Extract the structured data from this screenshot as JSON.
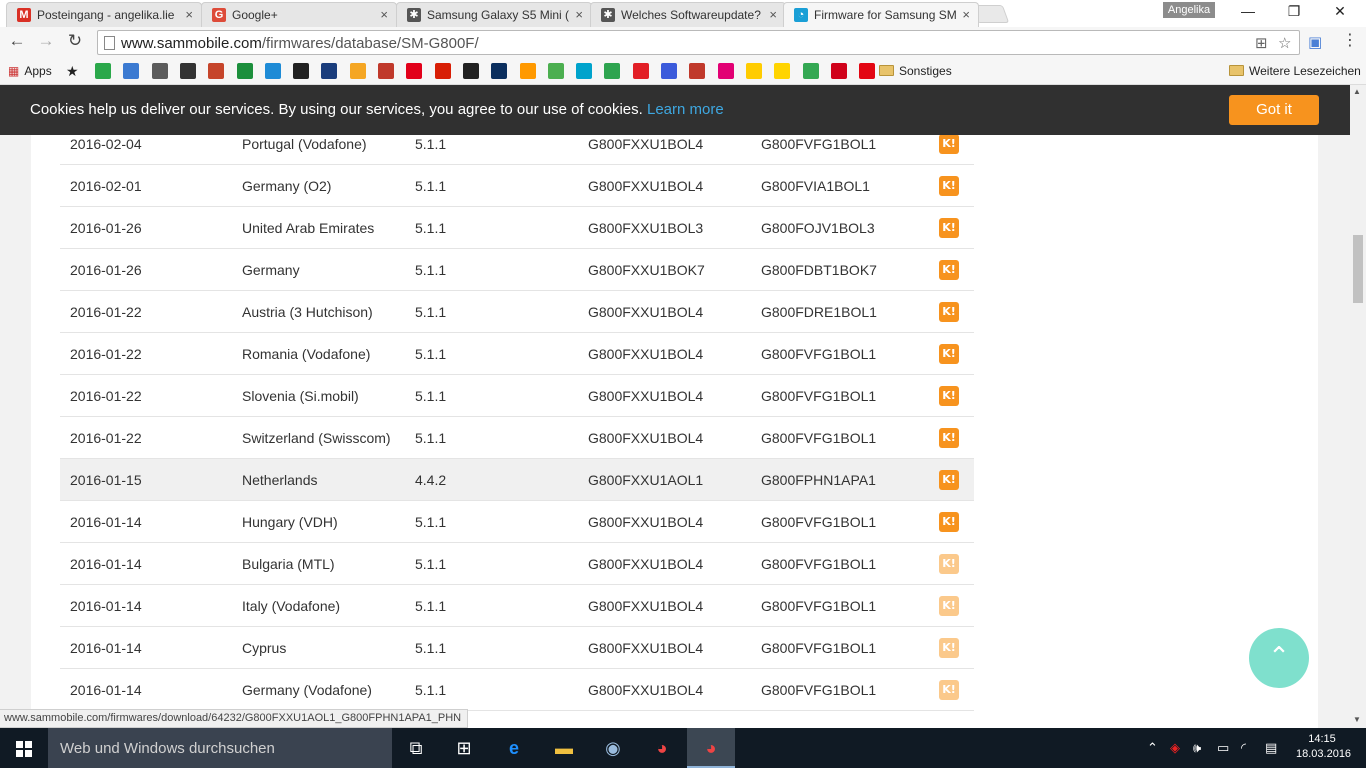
{
  "browser": {
    "tabs": [
      {
        "title": "Posteingang - angelika.lie",
        "icon": "gmail-icon",
        "color": "#d93025",
        "glyph": "M",
        "active": false
      },
      {
        "title": "Google+",
        "icon": "google-plus-icon",
        "color": "#dd4b39",
        "glyph": "G",
        "active": false
      },
      {
        "title": "Samsung Galaxy S5 Mini (",
        "icon": "android-icon",
        "color": "#555555",
        "glyph": "✱",
        "active": false
      },
      {
        "title": "Welches Softwareupdate?",
        "icon": "android-icon",
        "color": "#555555",
        "glyph": "✱",
        "active": false
      },
      {
        "title": "Firmware for Samsung SM",
        "icon": "sammobile-icon",
        "color": "#1a9fd6",
        "glyph": "◔",
        "active": true
      }
    ],
    "profile_name": "Angelika",
    "url_domain": "www.sammobile.com",
    "url_path": "/firmwares/database/SM-G800F/",
    "apps_label": "Apps",
    "bookmark_folder": "Sonstiges",
    "other_bookmarks": "Weitere Lesezeichen",
    "bookmark_icon_colors": [
      "#2aa84a",
      "#3b7ad1",
      "#5c5c5c",
      "#333333",
      "#c6452b",
      "#1c8f3c",
      "#1e8bd6",
      "#222222",
      "#1a3d7c",
      "#f5a623",
      "#c0392b",
      "#e2001a",
      "#d81e05",
      "#222222",
      "#0b2f5e",
      "#ff9900",
      "#4caf50",
      "#00a3cc",
      "#2ea44f",
      "#e21f26",
      "#3b5bdb",
      "#c0392b",
      "#e20074",
      "#ffcc00",
      "#ffd400",
      "#34a853",
      "#d0021b",
      "#e30613"
    ]
  },
  "cookie_banner": {
    "message": "Cookies help us deliver our services. By using our services, you agree to our use of cookies.",
    "learn_more": "Learn more",
    "button": "Got it"
  },
  "firmware_rows": [
    {
      "date": "2016-02-04",
      "region": "Portugal (Vodafone)",
      "os": "5.1.1",
      "pda": "G800FXXU1BOL4",
      "csc": "G800FVFG1BOL1",
      "faded": false,
      "highlight": false
    },
    {
      "date": "2016-02-01",
      "region": "Germany (O2)",
      "os": "5.1.1",
      "pda": "G800FXXU1BOL4",
      "csc": "G800FVIA1BOL1",
      "faded": false,
      "highlight": false
    },
    {
      "date": "2016-01-26",
      "region": "United Arab Emirates",
      "os": "5.1.1",
      "pda": "G800FXXU1BOL3",
      "csc": "G800FOJV1BOL3",
      "faded": false,
      "highlight": false
    },
    {
      "date": "2016-01-26",
      "region": "Germany",
      "os": "5.1.1",
      "pda": "G800FXXU1BOK7",
      "csc": "G800FDBT1BOK7",
      "faded": false,
      "highlight": false
    },
    {
      "date": "2016-01-22",
      "region": "Austria (3 Hutchison)",
      "os": "5.1.1",
      "pda": "G800FXXU1BOL4",
      "csc": "G800FDRE1BOL1",
      "faded": false,
      "highlight": false
    },
    {
      "date": "2016-01-22",
      "region": "Romania (Vodafone)",
      "os": "5.1.1",
      "pda": "G800FXXU1BOL4",
      "csc": "G800FVFG1BOL1",
      "faded": false,
      "highlight": false
    },
    {
      "date": "2016-01-22",
      "region": "Slovenia (Si.mobil)",
      "os": "5.1.1",
      "pda": "G800FXXU1BOL4",
      "csc": "G800FVFG1BOL1",
      "faded": false,
      "highlight": false
    },
    {
      "date": "2016-01-22",
      "region": "Switzerland (Swisscom)",
      "os": "5.1.1",
      "pda": "G800FXXU1BOL4",
      "csc": "G800FVFG1BOL1",
      "faded": false,
      "highlight": false
    },
    {
      "date": "2016-01-15",
      "region": "Netherlands",
      "os": "4.4.2",
      "pda": "G800FXXU1AOL1",
      "csc": "G800FPHN1APA1",
      "faded": false,
      "highlight": true
    },
    {
      "date": "2016-01-14",
      "region": "Hungary (VDH)",
      "os": "5.1.1",
      "pda": "G800FXXU1BOL4",
      "csc": "G800FVFG1BOL1",
      "faded": false,
      "highlight": false
    },
    {
      "date": "2016-01-14",
      "region": "Bulgaria (MTL)",
      "os": "5.1.1",
      "pda": "G800FXXU1BOL4",
      "csc": "G800FVFG1BOL1",
      "faded": true,
      "highlight": false
    },
    {
      "date": "2016-01-14",
      "region": "Italy (Vodafone)",
      "os": "5.1.1",
      "pda": "G800FXXU1BOL4",
      "csc": "G800FVFG1BOL1",
      "faded": true,
      "highlight": false
    },
    {
      "date": "2016-01-14",
      "region": "Cyprus",
      "os": "5.1.1",
      "pda": "G800FXXU1BOL4",
      "csc": "G800FVFG1BOL1",
      "faded": true,
      "highlight": false
    },
    {
      "date": "2016-01-14",
      "region": "Germany (Vodafone)",
      "os": "5.1.1",
      "pda": "G800FXXU1BOL4",
      "csc": "G800FVFG1BOL1",
      "faded": true,
      "highlight": false
    }
  ],
  "download_glyph": "K!",
  "status_url": "www.sammobile.com/firmwares/download/64232/G800FXXU1AOL1_G800FPHN1APA1_PHN",
  "taskbar": {
    "search_placeholder": "Web und Windows durchsuchen",
    "time": "14:15",
    "date": "18.03.2016"
  },
  "colors": {
    "accent": "#f7931e",
    "link": "#3ea7e0",
    "scroll_top": "#7fe0cd"
  }
}
